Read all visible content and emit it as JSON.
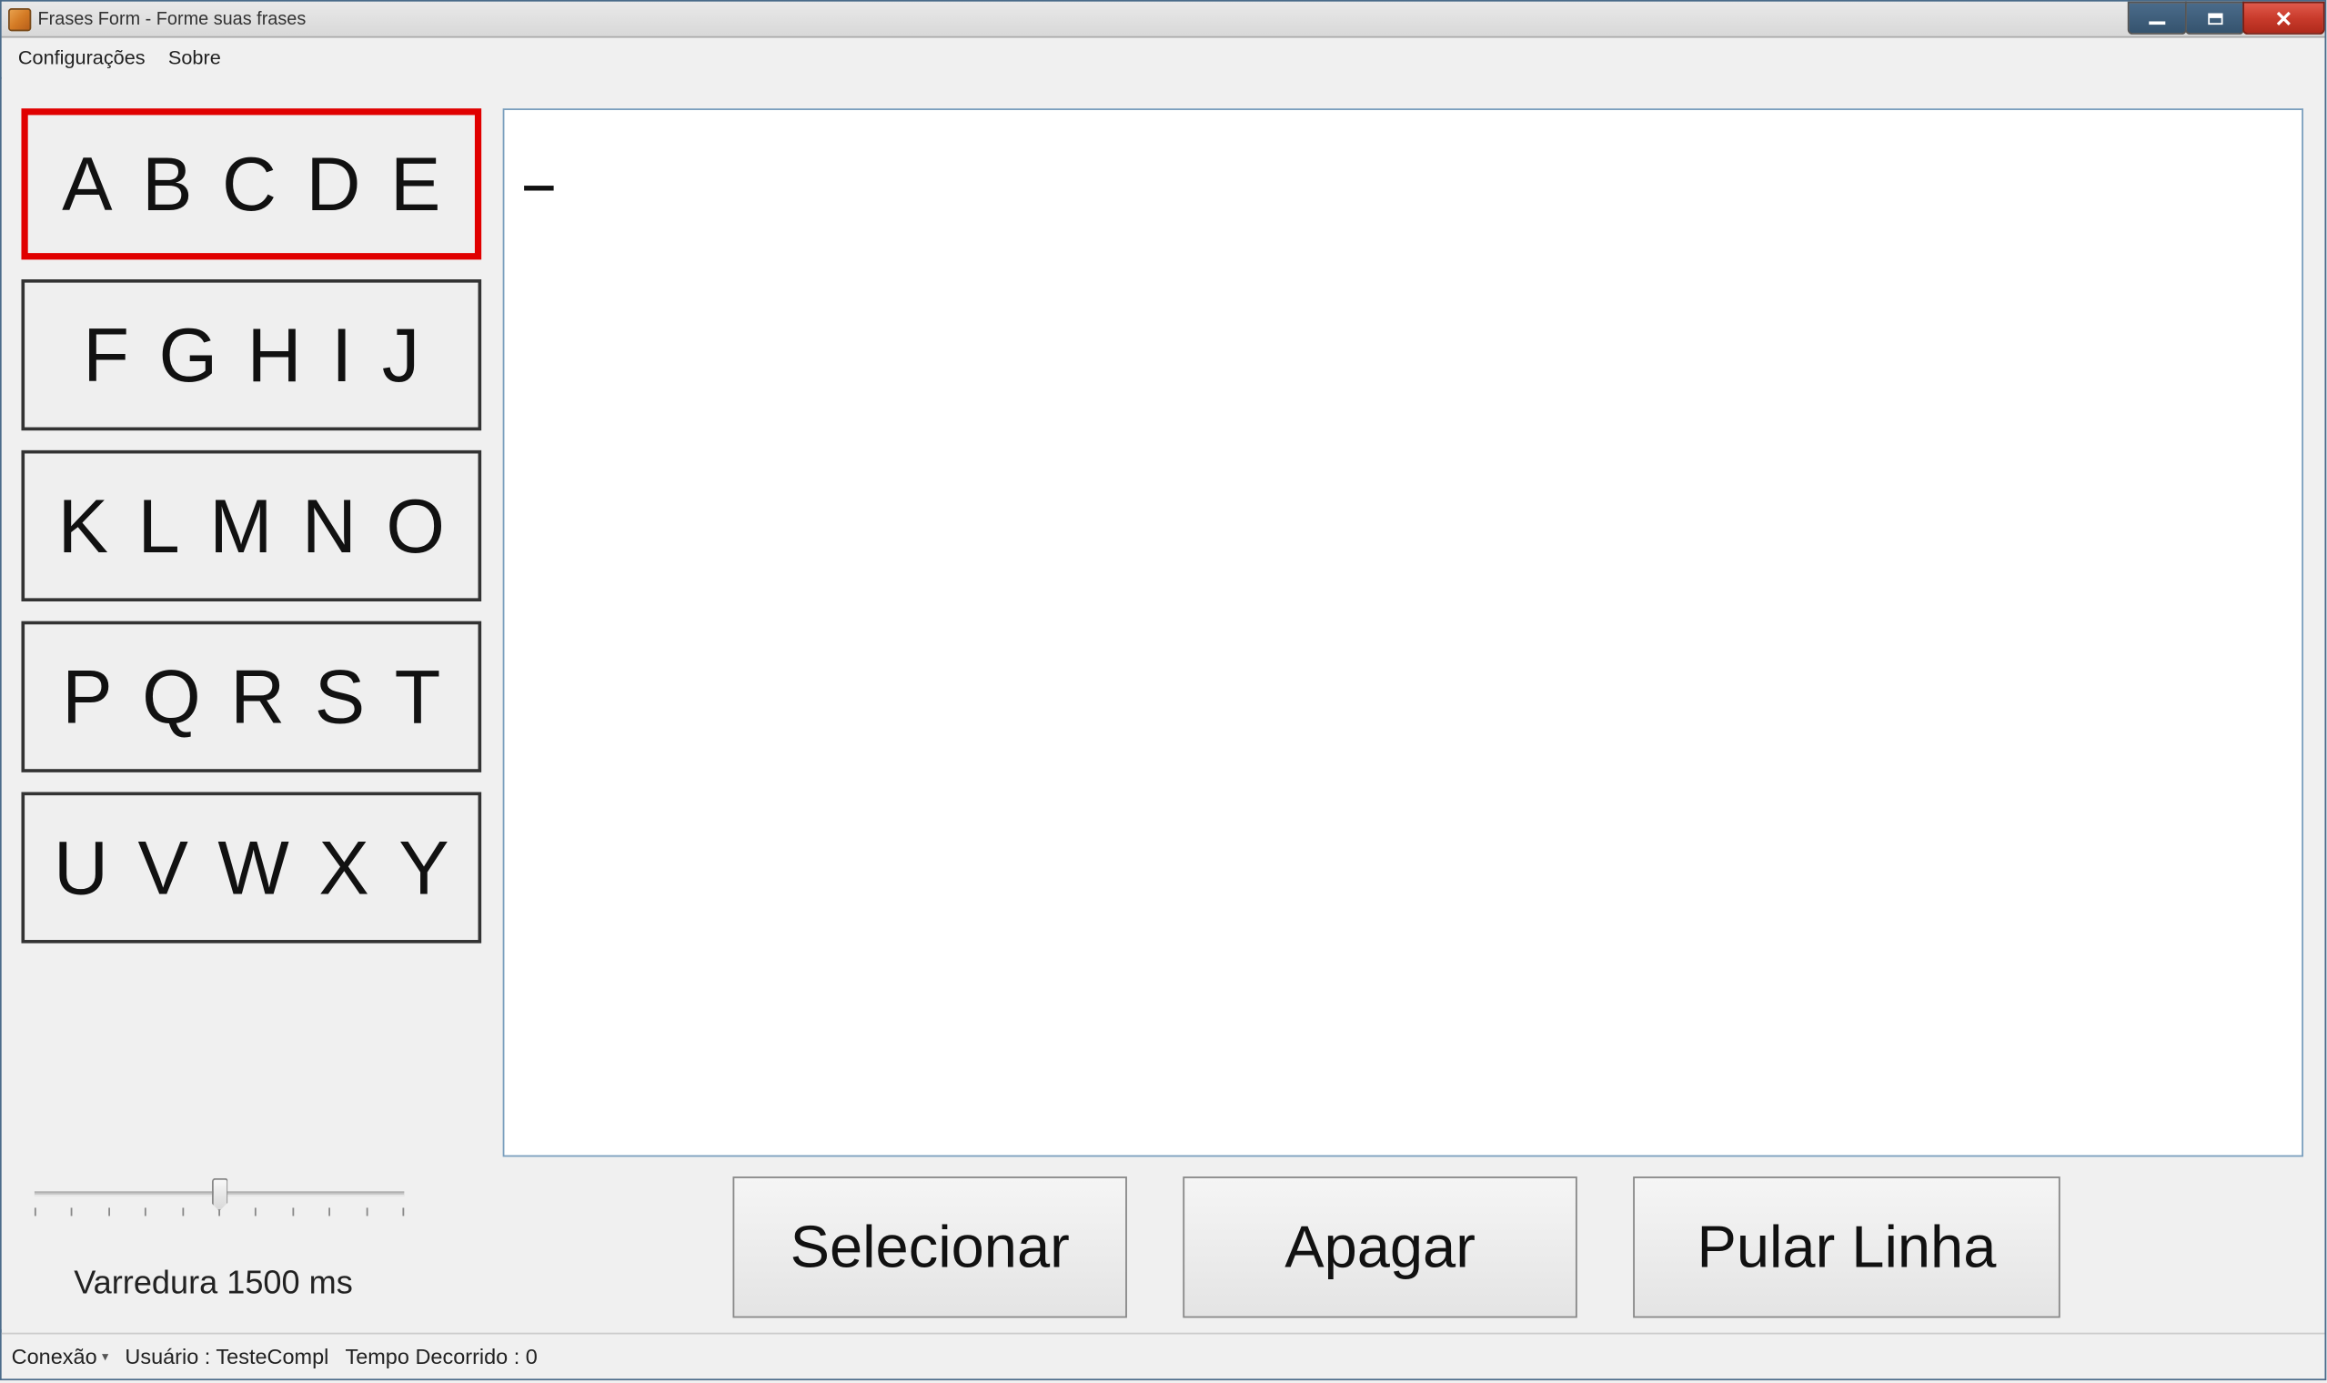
{
  "window": {
    "title": "Frases Form - Forme suas frases"
  },
  "menu": {
    "config": "Configurações",
    "about": "Sobre"
  },
  "letter_groups": [
    "ABCDE",
    "FGHIJ",
    "KLMNO",
    "PQRST",
    "UVWXY"
  ],
  "active_group_index": 0,
  "text_output": "",
  "slider": {
    "label": "Varredura 1500 ms",
    "value_ms": 1500,
    "ticks": 11,
    "position_percent": 50
  },
  "buttons": {
    "select": "Selecionar",
    "delete": "Apagar",
    "newline": "Pular Linha"
  },
  "statusbar": {
    "connection": "Conexão",
    "user": "Usuário : TesteCompl",
    "elapsed": "Tempo Decorrido : 0"
  }
}
